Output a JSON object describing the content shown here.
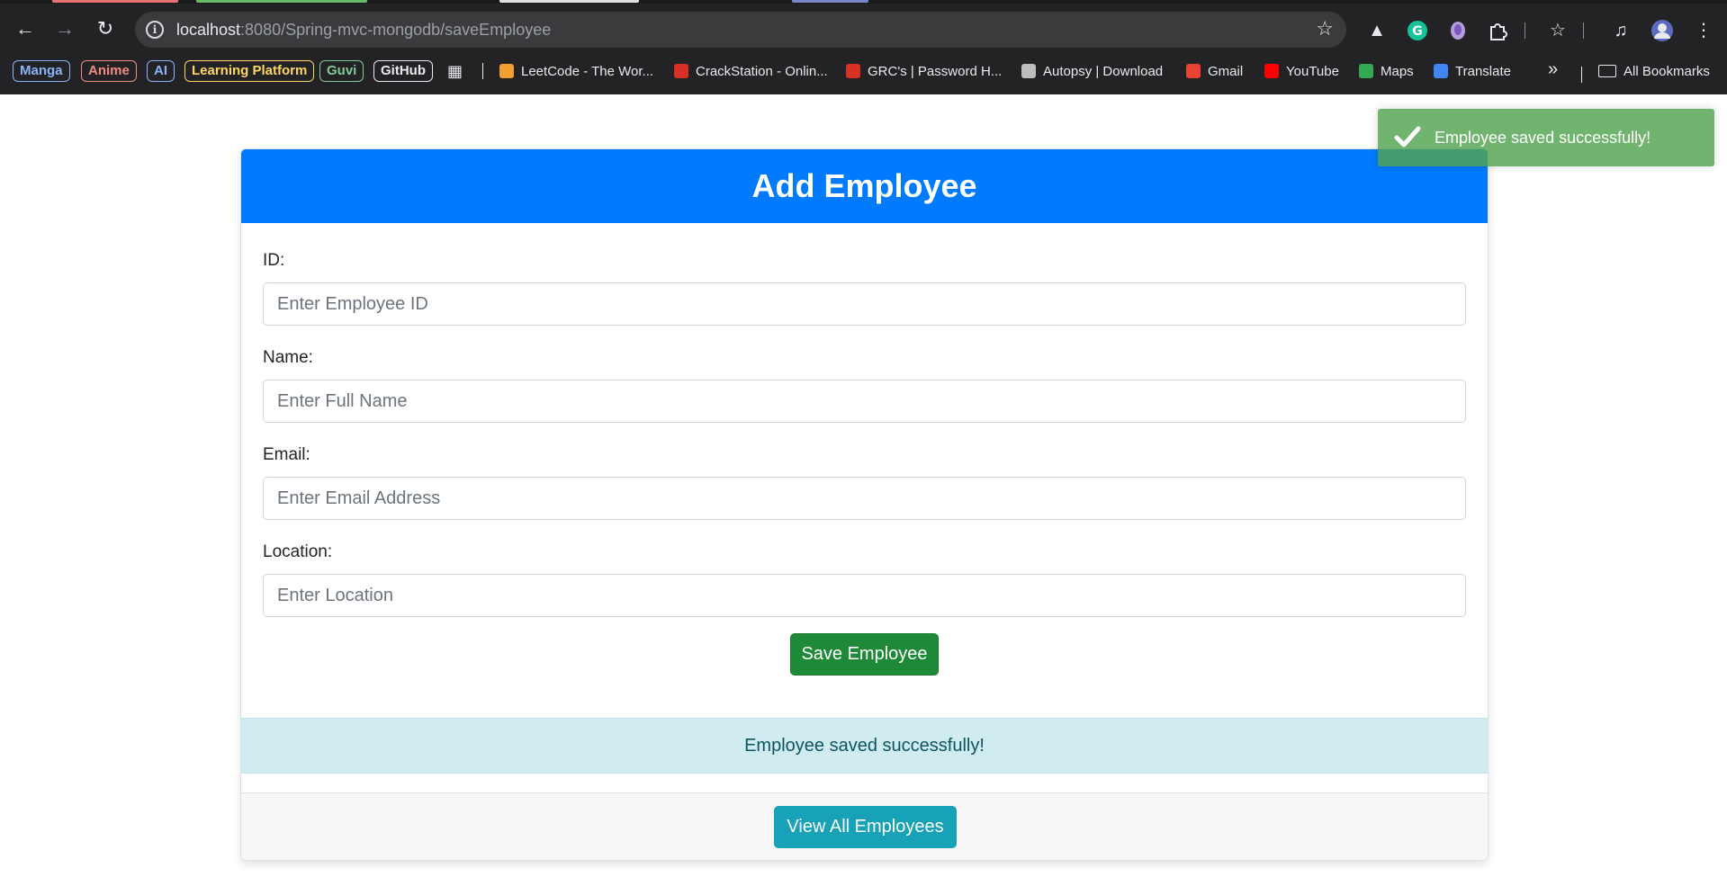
{
  "browser": {
    "tab_accents": [
      "#e57373",
      "#66bb6a",
      "#e0e0e0",
      "#7986cb"
    ],
    "url_host": "localhost",
    "url_rest": ":8080/Spring-mvc-mongodb/saveEmployee",
    "bookmark_chips": [
      {
        "label": "Manga",
        "color": "#8ab4f8"
      },
      {
        "label": "Anime",
        "color": "#f28b82"
      },
      {
        "label": "AI",
        "color": "#8ab4f8"
      },
      {
        "label": "Learning Platform",
        "color": "#fdd663"
      },
      {
        "label": "Guvi",
        "color": "#81c995"
      },
      {
        "label": "GitHub",
        "color": "#e8eaed"
      }
    ],
    "bookmarks": [
      {
        "label": "LeetCode - The Wor...",
        "icon": "leetcode-icon",
        "color": "#f0a030"
      },
      {
        "label": "CrackStation - Onlin...",
        "icon": "crackstation-icon",
        "color": "#d93025"
      },
      {
        "label": "GRC's | Password H...",
        "icon": "grc-icon",
        "color": "#d93025"
      },
      {
        "label": "Autopsy | Download",
        "icon": "autopsy-icon",
        "color": "#bdbdbd"
      },
      {
        "label": "Gmail",
        "icon": "gmail-icon",
        "color": "#ea4335"
      },
      {
        "label": "YouTube",
        "icon": "youtube-icon",
        "color": "#ff0000"
      },
      {
        "label": "Maps",
        "icon": "maps-icon",
        "color": "#34a853"
      },
      {
        "label": "Translate",
        "icon": "translate-icon",
        "color": "#4285f4"
      }
    ],
    "overflow_label": "»",
    "all_bookmarks_label": "All Bookmarks"
  },
  "form": {
    "title": "Add Employee",
    "fields": [
      {
        "label": "ID:",
        "placeholder": "Enter Employee ID",
        "value": ""
      },
      {
        "label": "Name:",
        "placeholder": "Enter Full Name",
        "value": ""
      },
      {
        "label": "Email:",
        "placeholder": "Enter Email Address",
        "value": ""
      },
      {
        "label": "Location:",
        "placeholder": "Enter Location",
        "value": ""
      }
    ],
    "save_label": "Save Employee",
    "alert_text": "Employee saved successfully!",
    "view_all_label": "View All Employees"
  },
  "toast": {
    "message": "Employee saved successfully!"
  },
  "colors": {
    "header": "#007bff",
    "save_button": "#1e8a38",
    "view_button": "#17a2b8",
    "alert_bg": "#d1ecf1",
    "toast_bg": "#51a351"
  }
}
